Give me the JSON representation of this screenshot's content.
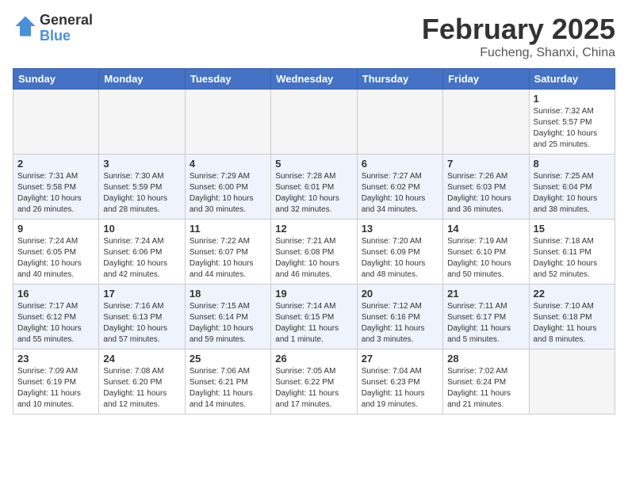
{
  "header": {
    "logo_line1": "General",
    "logo_line2": "Blue",
    "title": "February 2025",
    "subtitle": "Fucheng, Shanxi, China"
  },
  "calendar": {
    "days_of_week": [
      "Sunday",
      "Monday",
      "Tuesday",
      "Wednesday",
      "Thursday",
      "Friday",
      "Saturday"
    ],
    "weeks": [
      [
        {
          "day": "",
          "info": ""
        },
        {
          "day": "",
          "info": ""
        },
        {
          "day": "",
          "info": ""
        },
        {
          "day": "",
          "info": ""
        },
        {
          "day": "",
          "info": ""
        },
        {
          "day": "",
          "info": ""
        },
        {
          "day": "1",
          "info": "Sunrise: 7:32 AM\nSunset: 5:57 PM\nDaylight: 10 hours and 25 minutes."
        }
      ],
      [
        {
          "day": "2",
          "info": "Sunrise: 7:31 AM\nSunset: 5:58 PM\nDaylight: 10 hours and 26 minutes."
        },
        {
          "day": "3",
          "info": "Sunrise: 7:30 AM\nSunset: 5:59 PM\nDaylight: 10 hours and 28 minutes."
        },
        {
          "day": "4",
          "info": "Sunrise: 7:29 AM\nSunset: 6:00 PM\nDaylight: 10 hours and 30 minutes."
        },
        {
          "day": "5",
          "info": "Sunrise: 7:28 AM\nSunset: 6:01 PM\nDaylight: 10 hours and 32 minutes."
        },
        {
          "day": "6",
          "info": "Sunrise: 7:27 AM\nSunset: 6:02 PM\nDaylight: 10 hours and 34 minutes."
        },
        {
          "day": "7",
          "info": "Sunrise: 7:26 AM\nSunset: 6:03 PM\nDaylight: 10 hours and 36 minutes."
        },
        {
          "day": "8",
          "info": "Sunrise: 7:25 AM\nSunset: 6:04 PM\nDaylight: 10 hours and 38 minutes."
        }
      ],
      [
        {
          "day": "9",
          "info": "Sunrise: 7:24 AM\nSunset: 6:05 PM\nDaylight: 10 hours and 40 minutes."
        },
        {
          "day": "10",
          "info": "Sunrise: 7:24 AM\nSunset: 6:06 PM\nDaylight: 10 hours and 42 minutes."
        },
        {
          "day": "11",
          "info": "Sunrise: 7:22 AM\nSunset: 6:07 PM\nDaylight: 10 hours and 44 minutes."
        },
        {
          "day": "12",
          "info": "Sunrise: 7:21 AM\nSunset: 6:08 PM\nDaylight: 10 hours and 46 minutes."
        },
        {
          "day": "13",
          "info": "Sunrise: 7:20 AM\nSunset: 6:09 PM\nDaylight: 10 hours and 48 minutes."
        },
        {
          "day": "14",
          "info": "Sunrise: 7:19 AM\nSunset: 6:10 PM\nDaylight: 10 hours and 50 minutes."
        },
        {
          "day": "15",
          "info": "Sunrise: 7:18 AM\nSunset: 6:11 PM\nDaylight: 10 hours and 52 minutes."
        }
      ],
      [
        {
          "day": "16",
          "info": "Sunrise: 7:17 AM\nSunset: 6:12 PM\nDaylight: 10 hours and 55 minutes."
        },
        {
          "day": "17",
          "info": "Sunrise: 7:16 AM\nSunset: 6:13 PM\nDaylight: 10 hours and 57 minutes."
        },
        {
          "day": "18",
          "info": "Sunrise: 7:15 AM\nSunset: 6:14 PM\nDaylight: 10 hours and 59 minutes."
        },
        {
          "day": "19",
          "info": "Sunrise: 7:14 AM\nSunset: 6:15 PM\nDaylight: 11 hours and 1 minute."
        },
        {
          "day": "20",
          "info": "Sunrise: 7:12 AM\nSunset: 6:16 PM\nDaylight: 11 hours and 3 minutes."
        },
        {
          "day": "21",
          "info": "Sunrise: 7:11 AM\nSunset: 6:17 PM\nDaylight: 11 hours and 5 minutes."
        },
        {
          "day": "22",
          "info": "Sunrise: 7:10 AM\nSunset: 6:18 PM\nDaylight: 11 hours and 8 minutes."
        }
      ],
      [
        {
          "day": "23",
          "info": "Sunrise: 7:09 AM\nSunset: 6:19 PM\nDaylight: 11 hours and 10 minutes."
        },
        {
          "day": "24",
          "info": "Sunrise: 7:08 AM\nSunset: 6:20 PM\nDaylight: 11 hours and 12 minutes."
        },
        {
          "day": "25",
          "info": "Sunrise: 7:06 AM\nSunset: 6:21 PM\nDaylight: 11 hours and 14 minutes."
        },
        {
          "day": "26",
          "info": "Sunrise: 7:05 AM\nSunset: 6:22 PM\nDaylight: 11 hours and 17 minutes."
        },
        {
          "day": "27",
          "info": "Sunrise: 7:04 AM\nSunset: 6:23 PM\nDaylight: 11 hours and 19 minutes."
        },
        {
          "day": "28",
          "info": "Sunrise: 7:02 AM\nSunset: 6:24 PM\nDaylight: 11 hours and 21 minutes."
        },
        {
          "day": "",
          "info": ""
        }
      ]
    ]
  }
}
